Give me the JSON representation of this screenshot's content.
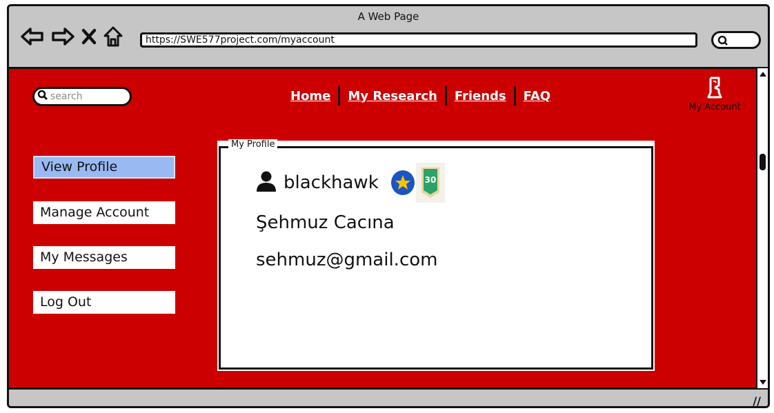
{
  "browser": {
    "title": "A Web Page",
    "url": "https://SWE577project.com/myaccount",
    "icons": [
      "back-arrow-icon",
      "forward-arrow-icon",
      "close-icon",
      "home-icon",
      "search-icon"
    ]
  },
  "site": {
    "search_placeholder": "search",
    "nav": [
      {
        "label": "Home"
      },
      {
        "label": "My Research"
      },
      {
        "label": "Friends"
      },
      {
        "label": "FAQ"
      }
    ],
    "account_label": "My Account"
  },
  "sidebar": {
    "items": [
      {
        "label": "View Profile",
        "active": true
      },
      {
        "label": "Manage Account"
      },
      {
        "label": "My Messages"
      },
      {
        "label": "Log Out"
      }
    ]
  },
  "profile": {
    "legend": "My Profile",
    "username": "blackhawk",
    "full_name": "Şehmuz Cacına",
    "email": "sehmuz@gmail.com",
    "badges": [
      {
        "icon": "star-badge-icon",
        "color": "#1a55c4"
      },
      {
        "icon": "level-badge-icon",
        "text": "30",
        "color": "#2aa36a"
      }
    ]
  },
  "colors": {
    "page_bg": "#cc0000",
    "active_item": "#99b9f3",
    "chrome": "#c6c6c6"
  }
}
